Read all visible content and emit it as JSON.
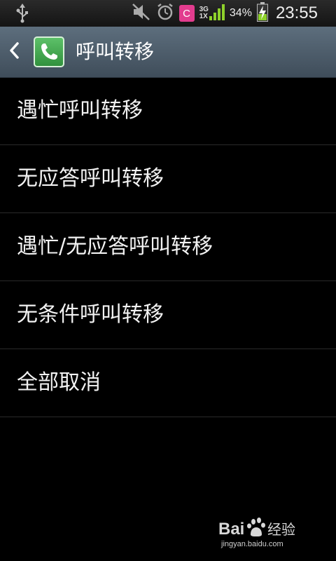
{
  "status_bar": {
    "left_icon": "usb-icon",
    "icons": [
      "mute-icon",
      "alarm-icon",
      "carrier-c-icon",
      "network-3g-1x",
      "signal-icon",
      "battery-charging-icon"
    ],
    "carrier_letter": "C",
    "network_top": "3G",
    "network_bottom": "1X",
    "battery_percent": "34%",
    "time": "23:55"
  },
  "header": {
    "back_icon": "chevron-left-icon",
    "app_icon": "phone-icon",
    "title": "呼叫转移"
  },
  "list": {
    "items": [
      {
        "label": "遇忙呼叫转移"
      },
      {
        "label": "无应答呼叫转移"
      },
      {
        "label": "遇忙/无应答呼叫转移"
      },
      {
        "label": "无条件呼叫转移"
      },
      {
        "label": "全部取消"
      }
    ]
  },
  "watermark": {
    "logo": "Bai du 经验",
    "url": "jingyan.baidu.com"
  },
  "colors": {
    "background": "#000000",
    "title_bar": "#4e5d6b",
    "app_icon_green": "#3fa34d",
    "carrier_pink": "#e23c8e",
    "signal_green": "#8ed12b"
  }
}
